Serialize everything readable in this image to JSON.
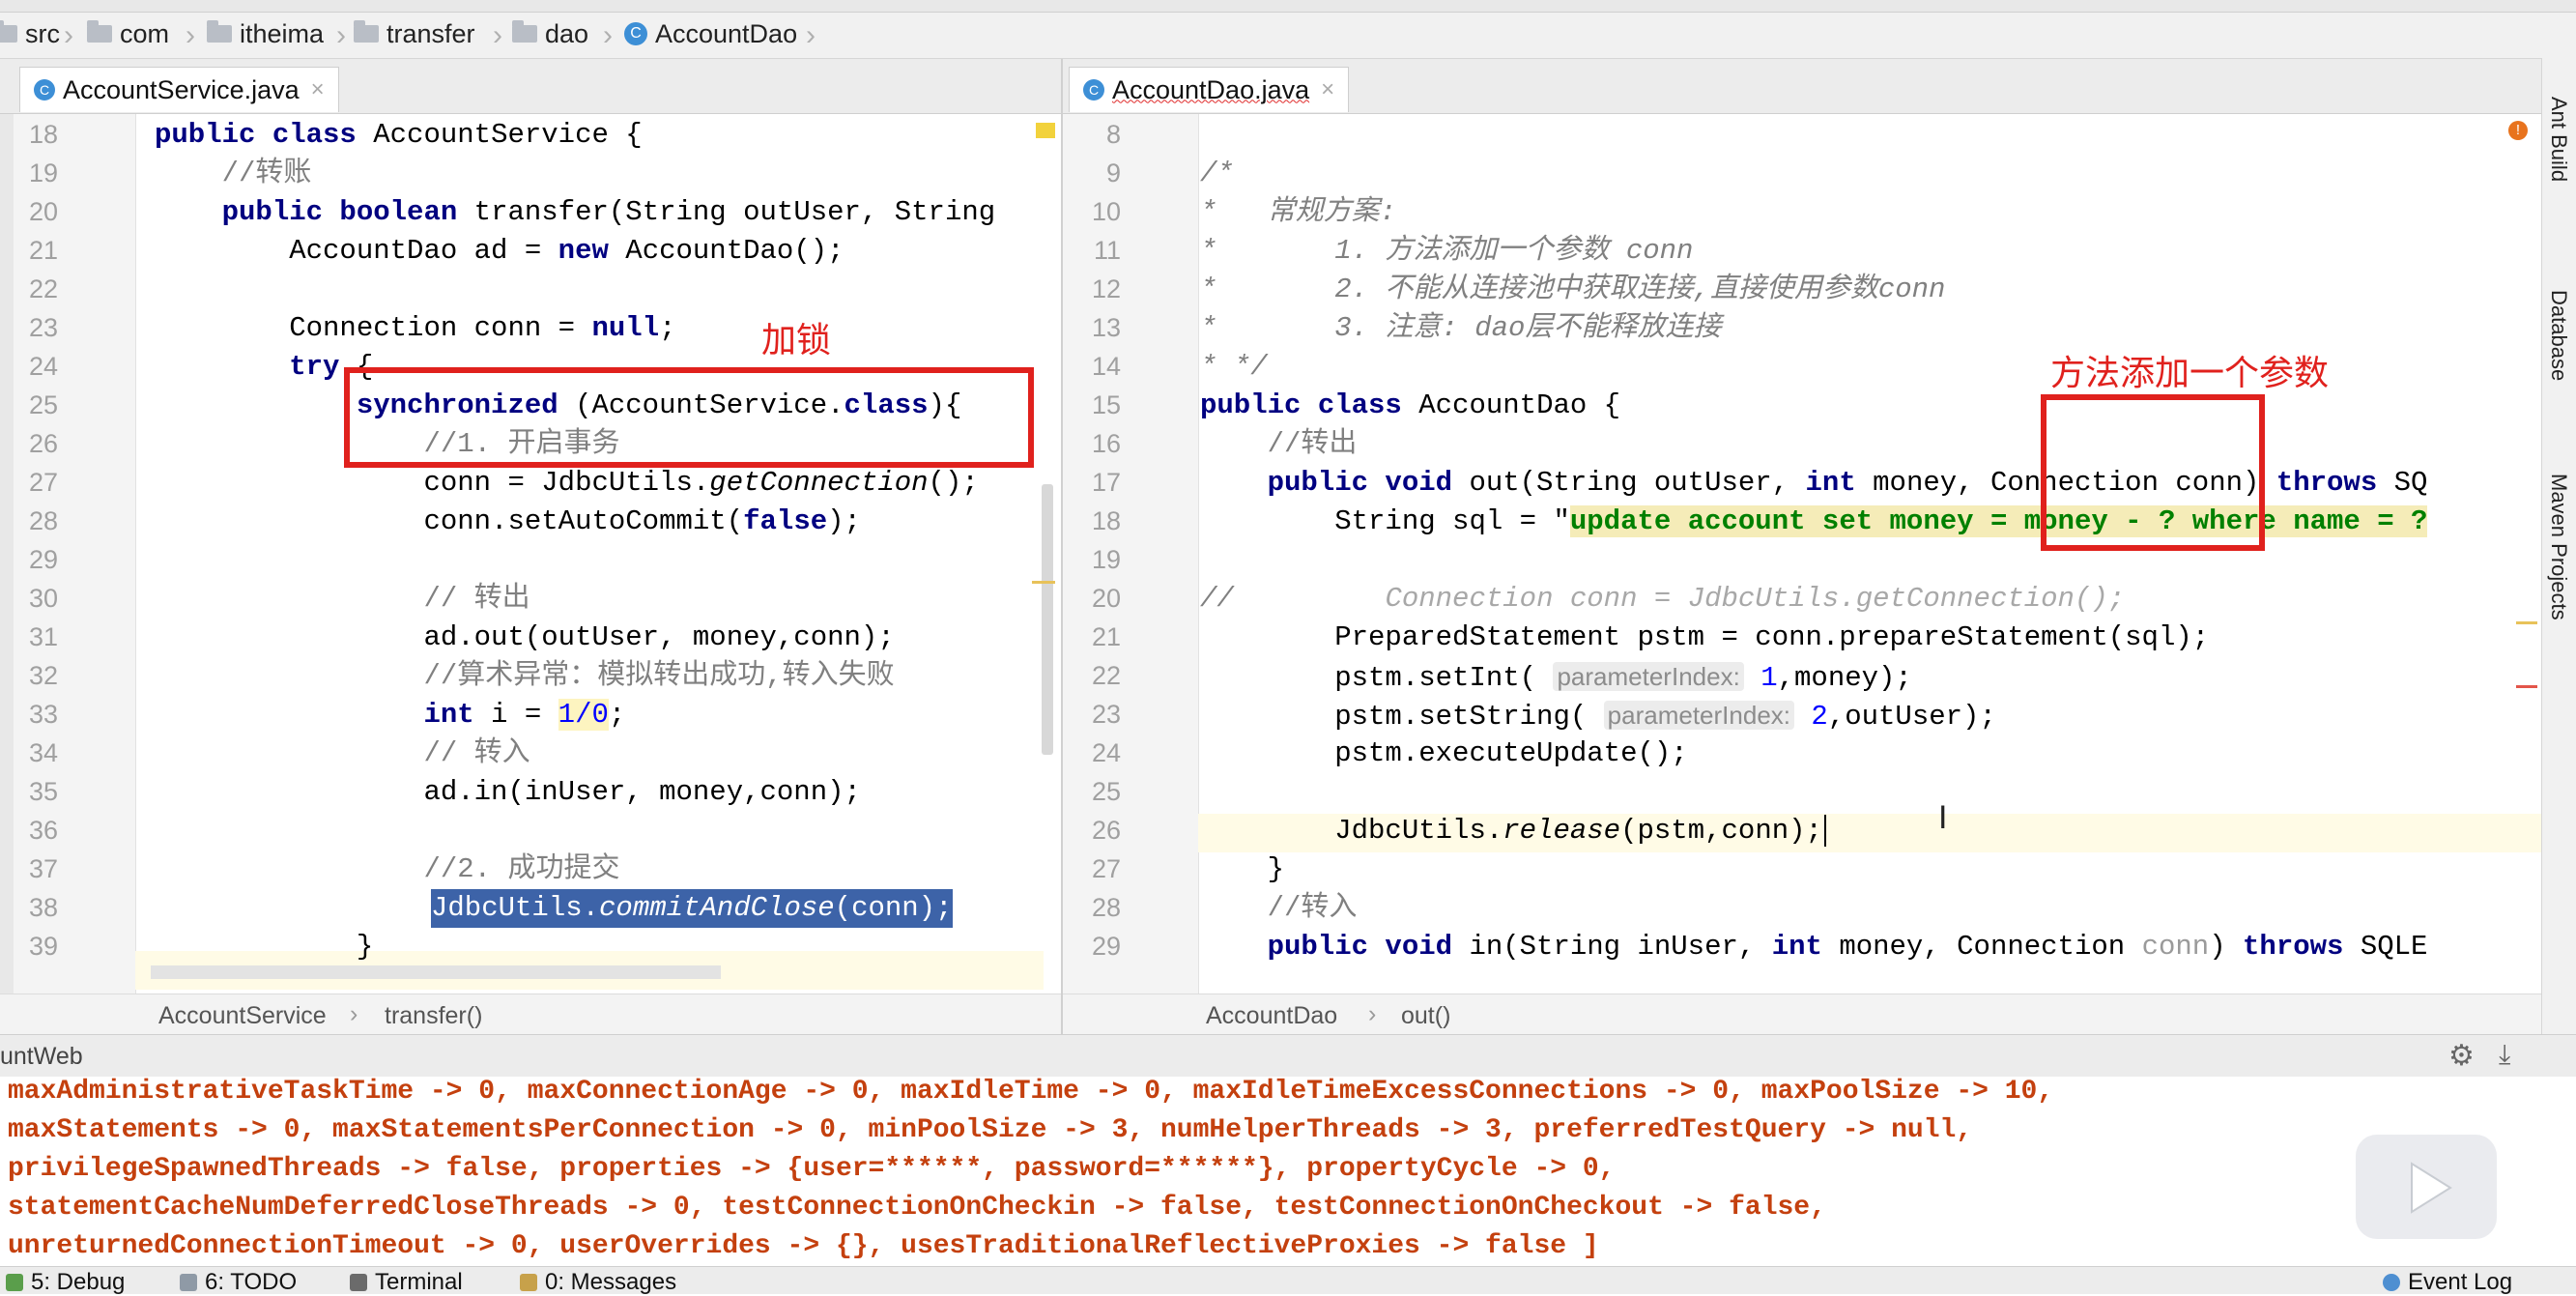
{
  "breadcrumb": {
    "items": [
      {
        "label": "src",
        "icon": "folder-icon"
      },
      {
        "label": "com",
        "icon": "folder-icon"
      },
      {
        "label": "itheima",
        "icon": "folder-icon"
      },
      {
        "label": "transfer",
        "icon": "folder-icon"
      },
      {
        "label": "dao",
        "icon": "folder-icon"
      },
      {
        "label": "AccountDao",
        "icon": "class-icon"
      }
    ]
  },
  "left_editor": {
    "tab_label": "AccountService.java",
    "status_path": [
      "AccountService",
      "transfer()"
    ],
    "line_numbers": [
      "18",
      "19",
      "20",
      "21",
      "22",
      "23",
      "24",
      "25",
      "26",
      "27",
      "28",
      "29",
      "30",
      "31",
      "32",
      "33",
      "34",
      "35",
      "36",
      "37",
      "38",
      "39"
    ],
    "annotation_label": "加锁",
    "code": {
      "l18a": "public class",
      "l18b": " AccountService {",
      "l19": "    //转账",
      "l20a": "    public boolean",
      "l20b": " transfer(String outUser, String",
      "l21a": "        AccountDao ad = ",
      "l21b": "new",
      "l21c": " AccountDao();",
      "l23a": "        Connection conn = ",
      "l23b": "null",
      "l23c": ";",
      "l24a": "        try",
      "l24b": " {",
      "l25a": "            synchronized",
      "l25b": " (AccountService.",
      "l25c": "class",
      "l25d": "){",
      "l26": "                //1. 开启事务",
      "l27a": "                conn = JdbcUtils.",
      "l27b": "getConnection",
      "l27c": "();",
      "l28a": "                conn.setAutoCommit(",
      "l28b": "false",
      "l28c": ");",
      "l30": "                // 转出",
      "l31": "                ad.out(outUser, money,conn);",
      "l32": "                //算术异常：模拟转出成功,转入失败",
      "l33a": "                int",
      "l33b": " i = ",
      "l33c": "1/0",
      "l33d": ";",
      "l34": "                // 转入",
      "l35": "                ad.in(inUser, money,conn);",
      "l37": "                //2. 成功提交",
      "l38a": "JdbcUtils.",
      "l38b": "commitAndClose",
      "l38c": "(conn);",
      "l39": "            }"
    }
  },
  "right_editor": {
    "tab_label": "AccountDao.java",
    "status_path": [
      "AccountDao",
      "out()"
    ],
    "line_numbers": [
      "8",
      "9",
      "10",
      "11",
      "12",
      "13",
      "14",
      "15",
      "16",
      "17",
      "18",
      "19",
      "20",
      "21",
      "22",
      "23",
      "24",
      "25",
      "26",
      "27",
      "28",
      "29"
    ],
    "annotation_label": "方法添加一个参数",
    "code": {
      "l9": "/*",
      "l10a": "*   常规方案:",
      "l11a": "*       1. 方法添加一个参数 ",
      "l11b": "conn",
      "l12a": "*       2. 不能从连接池中获取连接,直接使用参数",
      "l12b": "conn",
      "l13a": "*       3. 注意: ",
      "l13b": "dao",
      "l13c": "层不能释放连接",
      "l14": "* */",
      "l15a": "public class",
      "l15b": " AccountDao {",
      "l16": "    //转出",
      "l17a": "    public void",
      "l17b": " out(String outUser, ",
      "l17c": "int",
      "l17d": " money, Connection conn) ",
      "l17e": "throws",
      "l17f": " SQ",
      "l18a": "        String sql = \"",
      "l18b": "update account set money = money - ? where name = ?",
      "l20a": "//",
      "l20b": "         Connection conn = JdbcUtils.getConnection();",
      "l21": "        PreparedStatement pstm = conn.prepareStatement(sql);",
      "l22a": "        pstm.setInt( ",
      "l22hint": "parameterIndex:",
      "l22b": " 1",
      "l22c": ",money);",
      "l23a": "        pstm.setString( ",
      "l23hint": "parameterIndex:",
      "l23b": " 2",
      "l23c": ",outUser);",
      "l24": "        pstm.executeUpdate();",
      "l26a": "        JdbcUtils.",
      "l26b": "release",
      "l26c": "(pstm,conn);",
      "l27": "    }",
      "l28": "    //转入",
      "l29a": "    public void",
      "l29b": " in(String inUser, ",
      "l29c": "int",
      "l29d": " money, Connection ",
      "l29e": "conn",
      "l29f": ") ",
      "l29g": "throws",
      "l29h": " SQLE"
    }
  },
  "console": {
    "title": "untWeb",
    "lines": [
      "maxAdministrativeTaskTime -> 0, maxConnectionAge -> 0, maxIdleTime -> 0, maxIdleTimeExcessConnections -> 0, maxPoolSize -> 10,",
      "maxStatements -> 0, maxStatementsPerConnection -> 0, minPoolSize -> 3, numHelperThreads -> 3, preferredTestQuery -> null,",
      "privilegeSpawnedThreads -> false, properties -> {user=******, password=******}, propertyCycle -> 0,",
      "statementCacheNumDeferredCloseThreads -> 0, testConnectionOnCheckin -> false, testConnectionOnCheckout -> false,",
      "unreturnedConnectionTimeout -> 0, userOverrides -> {}, usesTraditionalReflectiveProxies -> false ]"
    ]
  },
  "bottom_bar": {
    "items": [
      "5: Debug",
      "6: TODO",
      "Terminal",
      "0: Messages"
    ],
    "event_log": "Event Log"
  },
  "right_toolbar": {
    "items": [
      "Ant Build",
      "Database",
      "Maven Projects"
    ]
  },
  "colors": {
    "annotation_red": "#e0211d",
    "keyword": "#000080",
    "string": "#008000",
    "comment": "#808080",
    "console_text": "#c4400e",
    "selection": "#3d63a8"
  }
}
